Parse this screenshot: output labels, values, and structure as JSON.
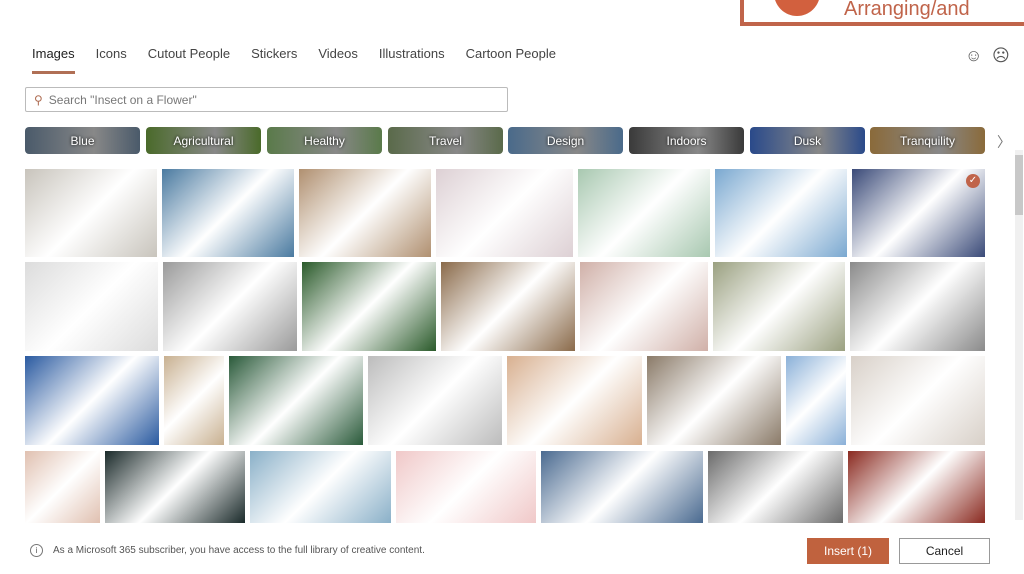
{
  "background_title": "Arranging/and",
  "tabs": [
    "Images",
    "Icons",
    "Cutout People",
    "Stickers",
    "Videos",
    "Illustrations",
    "Cartoon People"
  ],
  "active_tab": "Images",
  "feedback": {
    "smile": "☺",
    "frown": "☹"
  },
  "search": {
    "placeholder": "Search \"Insect on a Flower\""
  },
  "chips": [
    {
      "label": "Blue",
      "color": "#4a5a6a"
    },
    {
      "label": "Agricultural",
      "color": "#4a6a2a"
    },
    {
      "label": "Healthy",
      "color": "#5a7a4a"
    },
    {
      "label": "Travel",
      "color": "#5a6a4a"
    },
    {
      "label": "Design",
      "color": "#4a6a8a"
    },
    {
      "label": "Indoors",
      "color": "#3a3a3a"
    },
    {
      "label": "Dusk",
      "color": "#2a4a8a"
    },
    {
      "label": "Tranquility",
      "color": "#8a6a3a"
    }
  ],
  "accent": "#c0623e",
  "images": [
    [
      {
        "c": "#c8c4bc"
      },
      {
        "c": "#4a7aa0"
      },
      {
        "c": "#b09070"
      },
      {
        "c": "#ddd0d4"
      },
      {
        "c": "#a8c8b0"
      },
      {
        "c": "#7aa8d0"
      },
      {
        "c": "#3a4a78",
        "selected": true
      }
    ],
    [
      {
        "c": "#dcdcdc"
      },
      {
        "c": "#9a9a9a"
      },
      {
        "c": "#2a5a2a"
      },
      {
        "c": "#8a6a4a"
      },
      {
        "c": "#d0b0a8"
      },
      {
        "c": "#9aa080"
      },
      {
        "c": "#8a8a8a"
      }
    ],
    [
      {
        "c": "#2a5aa0"
      },
      {
        "c": "#c8b090"
      },
      {
        "c": "#2a5a3a"
      },
      {
        "c": "#bcbcbc"
      },
      {
        "c": "#d8b090"
      },
      {
        "c": "#8a7a68"
      },
      {
        "c": "#8ab0d8"
      },
      {
        "c": "#d8d0c8"
      }
    ],
    [
      {
        "c": "#e0c0b0"
      },
      {
        "c": "#1a2a2a"
      },
      {
        "c": "#8ab0c8"
      },
      {
        "c": "#f0c8c8"
      },
      {
        "c": "#4a6a90"
      },
      {
        "c": "#6a6a6a"
      },
      {
        "c": "#8a2a20"
      }
    ]
  ],
  "footer": {
    "info": "As a Microsoft 365 subscriber, you have access to the full library of creative content.",
    "insert": "Insert (1)",
    "cancel": "Cancel"
  }
}
